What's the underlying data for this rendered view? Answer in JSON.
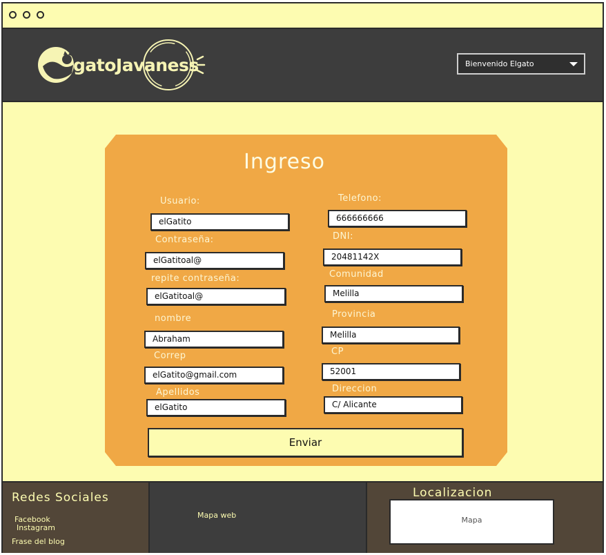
{
  "app": {
    "logo_text": "gatoJavaness"
  },
  "header": {
    "user_menu_label": "Bienvenido Elgato"
  },
  "form": {
    "title": "Ingreso",
    "left_fields": [
      {
        "label": "Usuario:",
        "value": "elGatito"
      },
      {
        "label": "Contraseña:",
        "value": "elGatitoal@"
      },
      {
        "label": "repite contraseña:",
        "value": "elGatitoal@"
      },
      {
        "label": "nombre",
        "value": "Abraham"
      },
      {
        "label": "Correp",
        "value": "elGatito@gmail.com"
      },
      {
        "label": "Apellidos",
        "value": "elGatito"
      }
    ],
    "right_fields": [
      {
        "label": "Telefono:",
        "value": "666666666"
      },
      {
        "label": "DNI:",
        "value": "20481142X"
      },
      {
        "label": "Comunidad",
        "value": "Melilla"
      },
      {
        "label": "Provincia",
        "value": "Melilla"
      },
      {
        "label": "CP",
        "value": "52001"
      },
      {
        "label": "Direccion",
        "value": "C/ Alicante"
      }
    ],
    "submit_label": "Enviar"
  },
  "footer": {
    "social": {
      "title": "Redes Sociales",
      "links": [
        "Facebook",
        "Instagram",
        "Frase del blog"
      ]
    },
    "sitemap": {
      "label": "Mapa web"
    },
    "location": {
      "title": "Localizacion",
      "map_label": "Mapa"
    }
  },
  "colors": {
    "page_background": "#fdfcb1",
    "header_background": "#3d3d3d",
    "form_card": "#f0a845",
    "footer_brown": "#524638"
  },
  "icons": [
    "window-dot-icon",
    "cat-logo-icon",
    "chevron-down-icon"
  ]
}
